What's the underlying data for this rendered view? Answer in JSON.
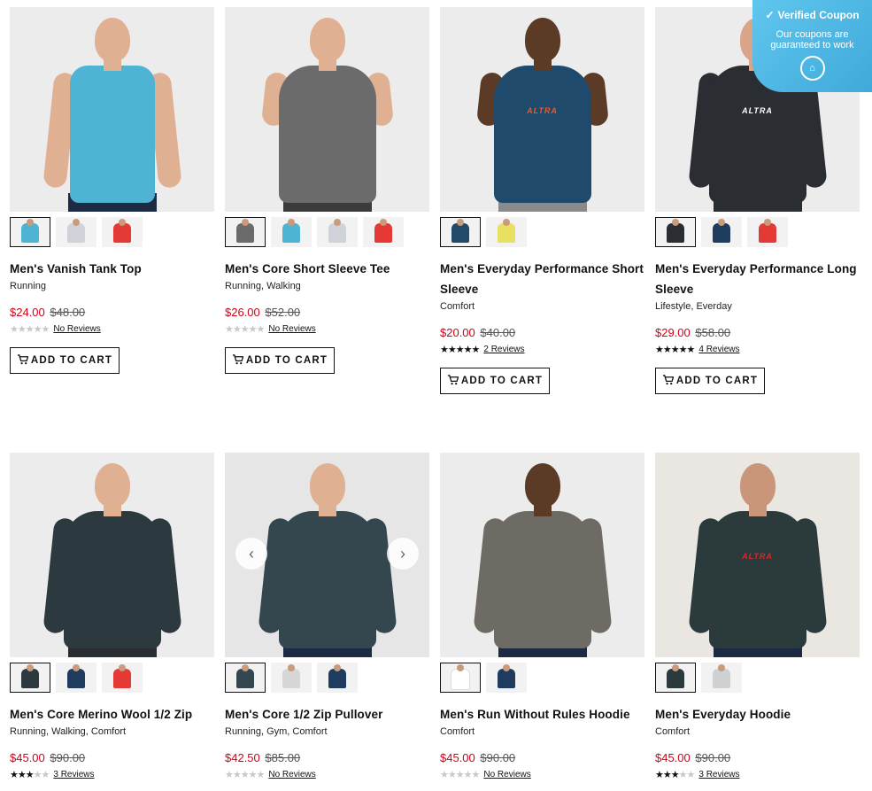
{
  "products": [
    {
      "name": "Men's Vanish Tank Top",
      "categories": "Running",
      "sale_price": "$24.00",
      "original_price": "$48.00",
      "rating": 0,
      "reviews_label": "No Reviews",
      "cart_label": "ADD TO CART",
      "bg": "#ececec",
      "shirt": "#4fb3d4",
      "pants": "#1d2a44",
      "skin": "#e0b093",
      "tank": true,
      "logo": "",
      "swatches": [
        "#4fb3d4",
        "#cfd2d8",
        "#e53935"
      ]
    },
    {
      "name": "Men's Core Short Sleeve Tee",
      "categories": "Running, Walking",
      "sale_price": "$26.00",
      "original_price": "$52.00",
      "rating": 0,
      "reviews_label": "No Reviews",
      "cart_label": "ADD TO CART",
      "bg": "#ececec",
      "shirt": "#6b6b6b",
      "pants": "#3b3b3b",
      "skin": "#e0b093",
      "tank": false,
      "logo": "",
      "swatches": [
        "#6b6b6b",
        "#4fb3d4",
        "#cfd2d8",
        "#e53935"
      ]
    },
    {
      "name": "Men's Everyday Performance Short Sleeve",
      "categories": "Comfort",
      "sale_price": "$20.00",
      "original_price": "$40.00",
      "rating": 4.5,
      "reviews_label": "2 Reviews",
      "cart_label": "ADD TO CART",
      "bg": "#ececec",
      "shirt": "#1f4a6b",
      "pants": "#8a8a8a",
      "skin": "#5b3a26",
      "tank": false,
      "logo": "ALTRA",
      "logo_color": "#e85b2a",
      "swatches": [
        "#1f4a6b",
        "#e8e060"
      ]
    },
    {
      "name": "Men's Everyday Performance Long Sleeve",
      "categories": "Lifestyle, Everday",
      "sale_price": "$29.00",
      "original_price": "$58.00",
      "rating": 4.5,
      "reviews_label": "4 Reviews",
      "cart_label": "ADD TO CART",
      "bg": "#ececec",
      "shirt": "#2a2e33",
      "pants": "#2a2e33",
      "skin": "#d9a487",
      "tank": false,
      "long": true,
      "logo": "ALTRA",
      "logo_color": "#ffffff",
      "swatches": [
        "#2a2e33",
        "#1f3b5e",
        "#e53935"
      ]
    },
    {
      "name": "Men's Core Merino Wool 1/2 Zip",
      "categories": "Running, Walking, Comfort",
      "sale_price": "$45.00",
      "original_price": "$90.00",
      "rating": 2.5,
      "reviews_label": "3 Reviews",
      "cart_label": "",
      "bg": "#ececec",
      "shirt": "#2c3a40",
      "pants": "#2a2e33",
      "skin": "#e0b093",
      "tank": false,
      "long": true,
      "logo": "",
      "swatches": [
        "#2c3a40",
        "#1f3b5e",
        "#e53935"
      ]
    },
    {
      "name": "Men's Core 1/2 Zip Pullover",
      "categories": "Running, Gym, Comfort",
      "sale_price": "$42.50",
      "original_price": "$85.00",
      "rating": 0,
      "reviews_label": "No Reviews",
      "cart_label": "",
      "bg": "#e6e6e6",
      "shirt": "#34474f",
      "pants": "#1d2a44",
      "skin": "#e0b093",
      "tank": false,
      "long": true,
      "logo": "",
      "swatches": [
        "#34474f",
        "#d6d6d6",
        "#1f3b5e"
      ],
      "arrows": true
    },
    {
      "name": "Men's Run Without Rules Hoodie",
      "categories": "Comfort",
      "sale_price": "$45.00",
      "original_price": "$90.00",
      "rating": 0,
      "reviews_label": "No Reviews",
      "cart_label": "",
      "bg": "#ececec",
      "shirt": "#6e6a64",
      "pants": "#1d2a44",
      "skin": "#5b3a26",
      "tank": false,
      "long": true,
      "logo": "",
      "swatches": [
        "#ffffff",
        "#1f3b5e"
      ]
    },
    {
      "name": "Men's Everyday Hoodie",
      "categories": "Comfort",
      "sale_price": "$45.00",
      "original_price": "$90.00",
      "rating": 2.5,
      "reviews_label": "3 Reviews",
      "cart_label": "",
      "bg": "#eae6e2",
      "shirt": "#2b3a3a",
      "pants": "#1d2a44",
      "skin": "#c9967a",
      "tank": false,
      "long": true,
      "logo": "ALTRA",
      "logo_color": "#d8282a",
      "swatches": [
        "#2b3a3a",
        "#cfd0d2"
      ]
    }
  ],
  "coupon": {
    "title": "Verified Coupon",
    "text": "Our coupons are guaranteed to work"
  }
}
